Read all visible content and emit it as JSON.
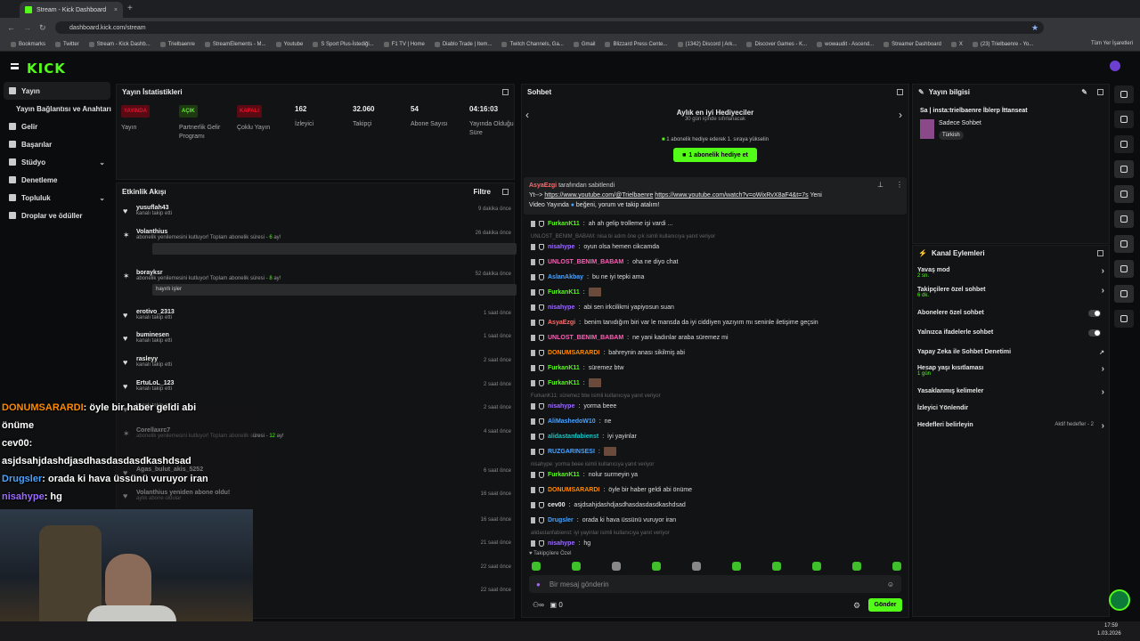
{
  "browser": {
    "tab_title": "Stream - Kick Dashboard",
    "url": "dashboard.kick.com/stream",
    "bookmarks": [
      "Bookmarks",
      "Twitter",
      "Stream - Kick Dashb...",
      "Trielbaenre",
      "StreamElements - M...",
      "Youtube",
      "S Sport Plus-İstediği...",
      "F1 TV | Home",
      "Diablo Trade | Item...",
      "Twitch Channels, Ga...",
      "Gmail",
      "Blizzard Press Cente...",
      "(1342) Discord | Ark...",
      "Discover Games - K...",
      "wowaudit - Ascend...",
      "Streamer Dashboard",
      "X",
      "(23) Trielbaenre - Yo..."
    ],
    "all_bookmarks": "Tüm Yer İşaretleri"
  },
  "brand": {
    "logo": "KICK",
    "accent": "#53fc18"
  },
  "sidebar": {
    "items": [
      {
        "label": "Yayın",
        "icon": "broadcast-icon"
      },
      {
        "label": "Yayın Bağlantısı ve Anahtarı",
        "icon": ""
      },
      {
        "label": "Gelir",
        "icon": "dollar-icon"
      },
      {
        "label": "Başarılar",
        "icon": "trophy-icon"
      },
      {
        "label": "Stüdyo",
        "icon": "studio-icon"
      },
      {
        "label": "Denetleme",
        "icon": "shield-icon"
      },
      {
        "label": "Topluluk",
        "icon": "users-icon"
      },
      {
        "label": "Droplar ve ödüller",
        "icon": "gift-icon"
      }
    ]
  },
  "stats": {
    "title": "Yayın İstatistikleri",
    "items": [
      {
        "badge": "YAYINDA",
        "label": "Yayın",
        "color": "#e8112d"
      },
      {
        "badge": "AÇIK",
        "label": "Partnerlik Gelir Programı",
        "color": "#53fc18"
      },
      {
        "badge": "KAPALI",
        "label": "Çoklu Yayın",
        "color": "#e8112d"
      },
      {
        "value": "162",
        "label": "İzleyici"
      },
      {
        "value": "32.060",
        "label": "Takipçi"
      },
      {
        "value": "54",
        "label": "Abone Sayısı"
      },
      {
        "value": "04:16:03",
        "label": "Yayında Olduğu Süre"
      }
    ]
  },
  "activity": {
    "title": "Etkinlik Akışı",
    "filter": "Filtre",
    "events": [
      {
        "name": "yusuflah43",
        "desc": "kanalı takip etti",
        "time": "9 dakika önce"
      },
      {
        "name": "Volanthius",
        "desc": "abonelik yenilemesini kutluyor! Toplam abonelik süresi -",
        "months": "6",
        "msg": "",
        "time": "26 dakika önce"
      },
      {
        "name": "borayksr",
        "desc": "abonelik yenilemesini kutluyor! Toplam abonelik süresi -",
        "months": "8",
        "msg": "hayırlı işler",
        "time": "52 dakika önce"
      },
      {
        "name": "erotivo_2313",
        "desc": "kanalı takip etti",
        "time": "1 saat önce"
      },
      {
        "name": "buminesen",
        "desc": "kanalı takip etti",
        "time": "1 saat önce"
      },
      {
        "name": "rasleyy",
        "desc": "kanalı takip etti",
        "time": "2 saat önce"
      },
      {
        "name": "ErtuLoL_123",
        "desc": "kanalı takip etti",
        "time": "2 saat önce"
      },
      {
        "name": "",
        "desc": "kanalı takip etti",
        "time": "2 saat önce"
      },
      {
        "name": "Corellaxrc7",
        "desc": "abonelik yenilemesini kutluyor! Toplam abonelik süresi -",
        "months": "12",
        "time": "4 saat önce"
      },
      {
        "name": "Agas_bulut_akis_5252",
        "desc": "",
        "time": "6 saat önce"
      },
      {
        "name": "Volanthius yeniden abone oldu!",
        "desc": "aylık abone oldular",
        "time": "16 saat önce"
      },
      {
        "name": "",
        "desc": "",
        "time": "16 saat önce"
      },
      {
        "name": "",
        "desc": "",
        "time": "21 saat önce"
      },
      {
        "name": "",
        "desc": "",
        "time": "22 saat önce"
      },
      {
        "name": "",
        "desc": "",
        "time": "22 saat önce"
      }
    ]
  },
  "chat": {
    "title": "Sohbet",
    "gifters_title": "Aylık en iyi Hediyeciler",
    "gifters_sub": "30 gün içinde sıfırlanacak",
    "gift_hint": "1 abonelik hediye ederek 1. sıraya yükselin",
    "gift_button": "1 abonelik hediye et",
    "pinned_by": "AsyaEzgi",
    "pinned_label": "tarafından sabitlendi",
    "pinned_text1": "Yt-->",
    "pinned_link1": "https://www.youtube.com/@Trielbaenre",
    "pinned_link2": "https://www.youtube.com/watch?v=oWixRvX8aF4&t=7s",
    "pinned_after": "Yeni",
    "pinned_text2": "Video Yayında",
    "pinned_text3": "beğeni, yorum ve takip atalım!",
    "messages": [
      {
        "user": "FurkanK11",
        "color": "#53fc18",
        "text": "ah ah gelip trolleme işi vardi ..."
      },
      {
        "reply": "UNLOST_BENIM_BABAM: nisa bi adım öne çık isimli kullanıcıya yanıt veriyor"
      },
      {
        "user": "nisahype",
        "color": "#9b6bff",
        "text": "oyun olsa hemen cikcamda"
      },
      {
        "user": "UNLOST_BENIM_BABAM",
        "color": "#ff5fb7",
        "text": "oha ne diyo chat"
      },
      {
        "user": "AslanAkbay",
        "color": "#4aa3ff",
        "text": "bu ne iyi tepki ama"
      },
      {
        "user": "FurkanK11",
        "color": "#53fc18",
        "text": "",
        "emote": true
      },
      {
        "user": "nisahype",
        "color": "#9b6bff",
        "text": "abi sen irkcilikmi yapiyosun suan"
      },
      {
        "user": "AsyaEzgi",
        "color": "#ff6b6b",
        "text": "benim tanıdığım biri var le mansda da iyi ciddiyen yazıyım mı seninle iletişime geçsin"
      },
      {
        "user": "UNLOST_BENIM_BABAM",
        "color": "#ff5fb7",
        "text": "ne yani kadınlar araba süremez mi"
      },
      {
        "user": "DONUMSARARDI",
        "color": "#ff8a00",
        "text": "bahreynin anası sikilmiş abi"
      },
      {
        "user": "FurkanK11",
        "color": "#53fc18",
        "text": "süremez btw"
      },
      {
        "user": "FurkanK11",
        "color": "#53fc18",
        "text": "",
        "emote": true
      },
      {
        "reply": "FurkanK11: süremez btw isimli kullanıcıya yanıt veriyor"
      },
      {
        "user": "nisahype",
        "color": "#9b6bff",
        "text": "yorma beee"
      },
      {
        "user": "AliMashedoW10",
        "color": "#4aa3ff",
        "text": "ne"
      },
      {
        "user": "alidastanfabienst",
        "color": "#19c3c3",
        "text": "iyi yayinlar"
      },
      {
        "user": "RUZGARINSESI",
        "color": "#4aa3ff",
        "text": "",
        "emote": true
      },
      {
        "reply": "nisahype: yorma beee isimli kullanıcıya yanıt veriyor"
      },
      {
        "user": "FurkanK11",
        "color": "#53fc18",
        "text": "nolur surmeyin ya"
      },
      {
        "user": "DONUMSARARDI",
        "color": "#ff8a00",
        "text": "öyle bir haber geldi abi önüme"
      },
      {
        "user": "cev00",
        "color": "#eeeeee",
        "text": "asjdsahjdashdjasdhasdasdasdkashdsad"
      },
      {
        "user": "Drugsler",
        "color": "#4aa3ff",
        "text": "orada ki hava üssünü vuruyor iran"
      },
      {
        "reply": "alidastanfabienst: iyi yayinlar isimli kullanıcıya yanıt veriyor"
      },
      {
        "user": "nisahype",
        "color": "#9b6bff",
        "text": "hg"
      }
    ],
    "followers_only": "Takipçilere Özel",
    "input_placeholder": "Bir mesaj gönderin",
    "send": "Gönder",
    "points": "0"
  },
  "info": {
    "title": "Yayın bilgisi",
    "stream_title": "Sa | insta:trielbaenre İblerp İttanseat",
    "category": "Sadece Sohbet",
    "tag": "Türkish"
  },
  "actions": {
    "title": "Kanal Eylemleri",
    "items": [
      {
        "label": "Yavaş mod",
        "sub": "2 sn.",
        "type": "chevron"
      },
      {
        "label": "Takipçilere özel sohbet",
        "sub": "6 dk.",
        "type": "chevron"
      },
      {
        "label": "Abonelere özel sohbet",
        "sub": "",
        "type": "toggle"
      },
      {
        "label": "Yalnızca ifadelerle sohbet",
        "sub": "",
        "type": "toggle"
      },
      {
        "label": "Yapay Zeka ile Sohbet Denetimi",
        "sub": "",
        "type": "link"
      },
      {
        "label": "Hesap yaşı kısıtlaması",
        "sub": "1 gün",
        "type": "chevron"
      },
      {
        "label": "Yasaklanmış kelimeler",
        "sub": "",
        "type": "chevron"
      },
      {
        "label": "İzleyici Yönlendir",
        "sub": "",
        "type": "none"
      },
      {
        "label": "Hedefleri belirleyin",
        "sub": "",
        "right": "Aktif hedefler - 2",
        "type": "chevron"
      }
    ]
  },
  "overlay": [
    {
      "user": "DONUMSARARDI",
      "text": ": öyle bir haber geldi abi",
      "color": "#ff8a00"
    },
    {
      "user": "",
      "text": "önüme",
      "color": "#ffffff"
    },
    {
      "user": "cev00",
      "text": ":",
      "color": "#ffffff"
    },
    {
      "user": "",
      "text": "asjdsahjdashdjasdhasdasdasdkashdsad",
      "color": "#ffffff"
    },
    {
      "user": "Drugsler",
      "text": ": orada ki hava üssünü vuruyor iran",
      "color": "#4aa3ff"
    },
    {
      "user": "nisahype",
      "text": ": hg",
      "color": "#9b6bff"
    }
  ],
  "taskbar": {
    "time": "17:59",
    "date": "1.03.2026"
  }
}
